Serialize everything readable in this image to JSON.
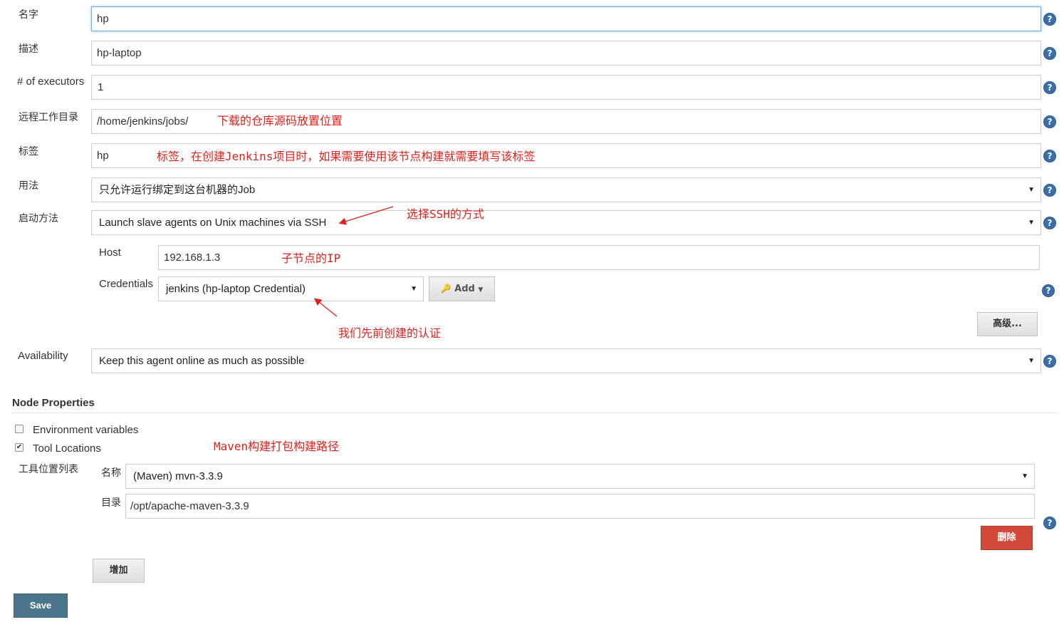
{
  "fields": {
    "name": {
      "label": "名字",
      "value": "hp"
    },
    "description": {
      "label": "描述",
      "value": "hp-laptop"
    },
    "executors": {
      "label": "# of executors",
      "value": "1"
    },
    "remote_dir": {
      "label": "远程工作目录",
      "value": "/home/jenkins/jobs/"
    },
    "labels": {
      "label": "标签",
      "value": "hp"
    },
    "usage": {
      "label": "用法",
      "value": "只允许运行绑定到这台机器的Job"
    },
    "launch": {
      "label": "启动方法",
      "value": "Launch slave agents on Unix machines via SSH"
    },
    "host": {
      "label": "Host",
      "value": "192.168.1.3"
    },
    "credentials": {
      "label": "Credentials",
      "value": "jenkins (hp-laptop Credential)",
      "add_label": "Add"
    },
    "advanced_label": "高级...",
    "availability": {
      "label": "Availability",
      "value": "Keep this agent online as much as possible"
    }
  },
  "node_properties": {
    "title": "Node Properties",
    "env_vars": {
      "label": "Environment variables",
      "checked": false
    },
    "tool_locations": {
      "label": "Tool Locations",
      "checked": true
    },
    "tool_list_label": "工具位置列表",
    "tool_name": {
      "label": "名称",
      "value": "(Maven) mvn-3.3.9"
    },
    "tool_dir": {
      "label": "目录",
      "value": "/opt/apache-maven-3.3.9"
    },
    "delete_label": "删除",
    "add_label": "增加"
  },
  "save_label": "Save",
  "annotations": {
    "remote_dir": "下载的仓库源码放置位置",
    "labels": "标签，在创建Jenkins项目时，如果需要使用该节点构建就需要填写该标签",
    "launch": "选择SSH的方式",
    "host": "子节点的IP",
    "credentials": "我们先前创建的认证",
    "maven": "Maven构建打包构建路径"
  },
  "colors": {
    "annotation": "#e0201a",
    "help": "#3b6ea8",
    "delete": "#d24939",
    "save": "#4b758b"
  }
}
